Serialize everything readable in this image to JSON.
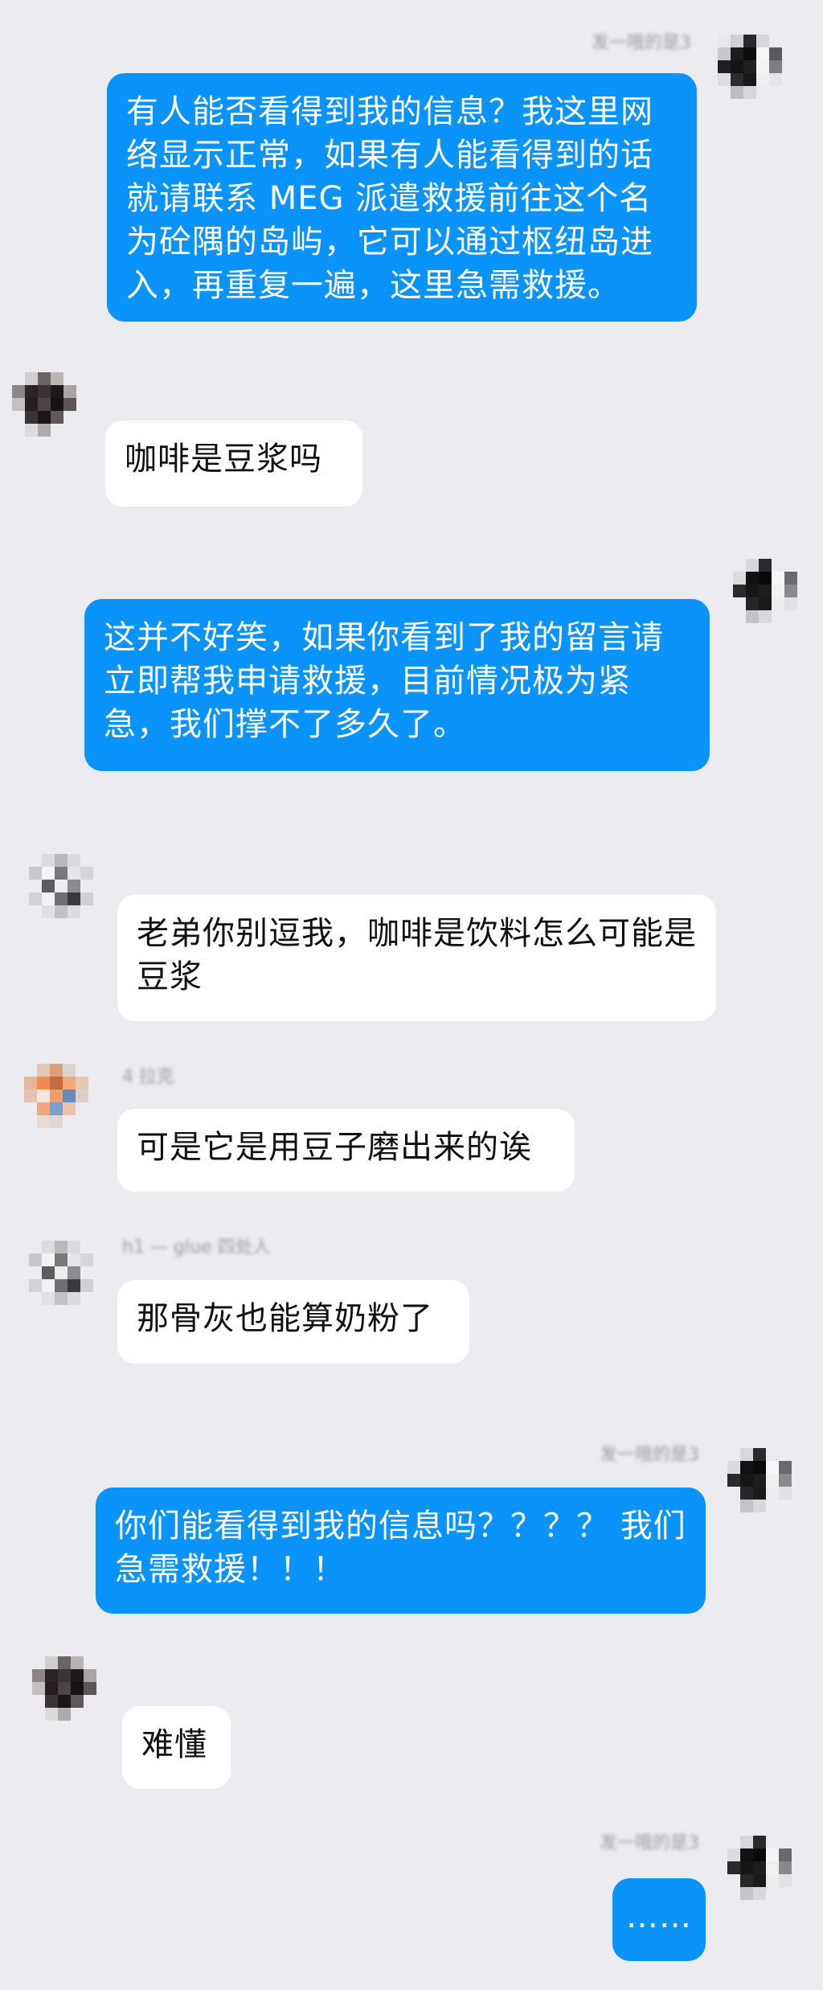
{
  "colors": {
    "background": "#ebebf0",
    "outgoing_bubble": "#0a93fb",
    "incoming_bubble": "#ffffff",
    "outgoing_text": "#ffffff",
    "incoming_text": "#111111"
  },
  "messages": [
    {
      "direction": "outgoing",
      "sender_meta": "发一哦的是3",
      "avatar": "pixelated-avatar-panda",
      "text": "有人能否看得到我的信息？我这里网络显示正常，如果有人能看得到的话就请联系 MEG 派遣救援前往这个名为砼隅的岛屿，它可以通过枢纽岛进入，再重复一遍，这里急需救援。"
    },
    {
      "direction": "incoming",
      "sender_meta": "",
      "avatar": "pixelated-avatar-dark",
      "text": "咖啡是豆浆吗"
    },
    {
      "direction": "outgoing",
      "sender_meta": "",
      "avatar": "pixelated-avatar-panda",
      "text": "这并不好笑，如果你看到了我的留言请立即帮我申请救援，目前情况极为紧急，我们撑不了多久了。"
    },
    {
      "direction": "incoming",
      "sender_meta": "",
      "avatar": "pixelated-avatar-grey",
      "text": "老弟你别逗我，咖啡是饮料怎么可能是豆浆"
    },
    {
      "direction": "incoming",
      "sender_meta": "4 拉克",
      "avatar": "pixelated-avatar-orange",
      "text": "可是它是用豆子磨出来的诶"
    },
    {
      "direction": "incoming",
      "sender_meta": "h1 — glue 四处人",
      "avatar": "pixelated-avatar-grey",
      "text": "那骨灰也能算奶粉了"
    },
    {
      "direction": "outgoing",
      "sender_meta": "发一哦的是3",
      "avatar": "pixelated-avatar-panda",
      "text": "你们能看得到我的信息吗？？？？ 我们急需救援！！！"
    },
    {
      "direction": "incoming",
      "sender_meta": "",
      "avatar": "pixelated-avatar-dark",
      "text": "难懂"
    },
    {
      "direction": "outgoing",
      "sender_meta": "发一哦的是3",
      "avatar": "pixelated-avatar-panda",
      "text": "……"
    }
  ]
}
